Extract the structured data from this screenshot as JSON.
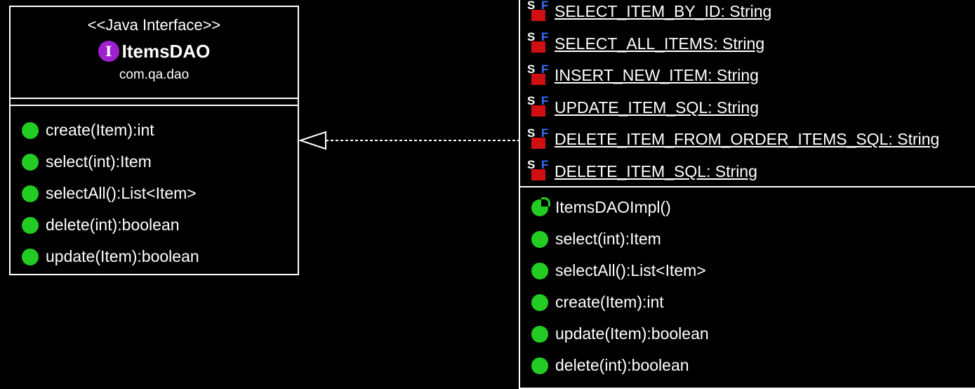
{
  "interface": {
    "stereotype": "<<Java Interface>>",
    "icon_letter": "I",
    "name": "ItemsDAO",
    "package": "com.qa.dao",
    "methods": [
      "create(Item):int",
      "select(int):Item",
      "selectAll():List<Item>",
      "delete(int):boolean",
      "update(Item):boolean"
    ]
  },
  "implementation": {
    "fields": [
      "SELECT_ITEM_BY_ID: String",
      "SELECT_ALL_ITEMS: String",
      "INSERT_NEW_ITEM: String",
      "UPDATE_ITEM_SQL: String",
      "DELETE_ITEM_FROM_ORDER_ITEMS_SQL: String",
      "DELETE_ITEM_SQL: String"
    ],
    "field_badge": {
      "s": "S",
      "f": "F"
    },
    "constructor": "ItemsDAOImpl()",
    "methods": [
      "select(int):Item",
      "selectAll():List<Item>",
      "create(Item):int",
      "update(Item):boolean",
      "delete(int):boolean"
    ]
  },
  "colors": {
    "background": "#000000",
    "border": "#ffffff",
    "method_icon": "#22cc22",
    "interface_icon": "#a020d0",
    "static_final_lock": "#d01010",
    "final_letter": "#3b6dff"
  }
}
